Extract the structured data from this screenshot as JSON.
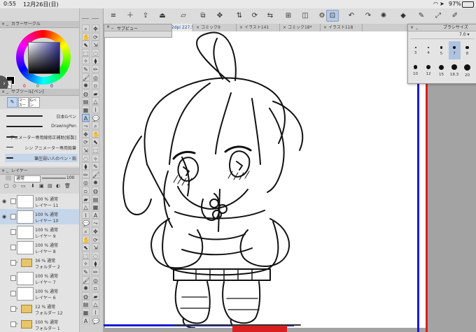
{
  "status_bar": {
    "time": "0:55",
    "date": "12月26日(日)",
    "battery": "97%"
  },
  "color_panel": {
    "title": "カラーサークル",
    "values": [
      "0",
      "0",
      "0"
    ],
    "colors": {
      "main": "#000000",
      "sub": "#ffffff",
      "hue_square": "#3a3aa0"
    }
  },
  "subtool_panel": {
    "title": "サブツール[ペン]",
    "tabs": [
      "ペン",
      "マーカー",
      "Gペン"
    ],
    "brushes": [
      "日本Gペン",
      "DrawingPen",
      "アニメーター専用線修正補助[紙製]",
      "シン アニメーター専用鉛筆",
      "筆圧弱い人のペン・鉛"
    ],
    "selected_brush_index": 4
  },
  "layer_panel": {
    "title": "レイヤー",
    "blend_mode": "通常",
    "opacity": "100",
    "layers": [
      {
        "opacity": "100 %",
        "mode": "通常",
        "name": "レイヤー 11",
        "type": "layer",
        "visible": true,
        "selected": false
      },
      {
        "opacity": "100 %",
        "mode": "通常",
        "name": "レイヤー 10",
        "type": "layer",
        "visible": true,
        "selected": true
      },
      {
        "opacity": "100 %",
        "mode": "通常",
        "name": "レイヤー 9",
        "type": "layer",
        "visible": false,
        "selected": false
      },
      {
        "opacity": "100 %",
        "mode": "通常",
        "name": "レイヤー 8",
        "type": "layer",
        "visible": false,
        "selected": false
      },
      {
        "opacity": "36 %",
        "mode": "通常",
        "name": "フォルダー 2",
        "type": "folder",
        "visible": false,
        "selected": false
      },
      {
        "opacity": "100 %",
        "mode": "通常",
        "name": "レイヤー 7",
        "type": "layer",
        "visible": false,
        "selected": false
      },
      {
        "opacity": "100 %",
        "mode": "通常",
        "name": "レイヤー 6",
        "type": "layer",
        "visible": false,
        "selected": false
      },
      {
        "opacity": "12 %",
        "mode": "通常",
        "name": "フォルダー 12",
        "type": "folder",
        "visible": false,
        "selected": false
      },
      {
        "opacity": "100 %",
        "mode": "通常",
        "name": "フォルダー 1",
        "type": "folder",
        "visible": false,
        "selected": false
      }
    ]
  },
  "canvas_tabs": [
    {
      "label": "イラスト145* (756 x 756px 72dpi 227.5%)",
      "active": true
    },
    {
      "label": "コミック9",
      "active": false
    },
    {
      "label": "イラスト141",
      "active": false
    },
    {
      "label": "コミック18*",
      "active": false
    },
    {
      "label": "イラスト118",
      "active": false
    }
  ],
  "navigator": {
    "title": "サブビュー"
  },
  "brush_size_popup": {
    "title": "ブラシサイズ",
    "current": "7.0",
    "sizes": [
      "3",
      "4",
      "5",
      "7",
      "8",
      "10",
      "12",
      "15",
      "18.3",
      "20"
    ],
    "selected_index": 3
  },
  "toolbar_icons": [
    "menu-icon",
    "new-file-icon",
    "open-icon",
    "save-icon",
    "clear-icon",
    "transform-icon",
    "move-icon",
    "flip-icon",
    "rotate-icon",
    "snap-icon",
    "ruler-icon",
    "perspective-icon",
    "settings-icon",
    "undo-icon",
    "redo-icon",
    "loading-icon",
    "fill-icon",
    "pen-icon",
    "fullscreen-icon",
    "edit-icon"
  ]
}
